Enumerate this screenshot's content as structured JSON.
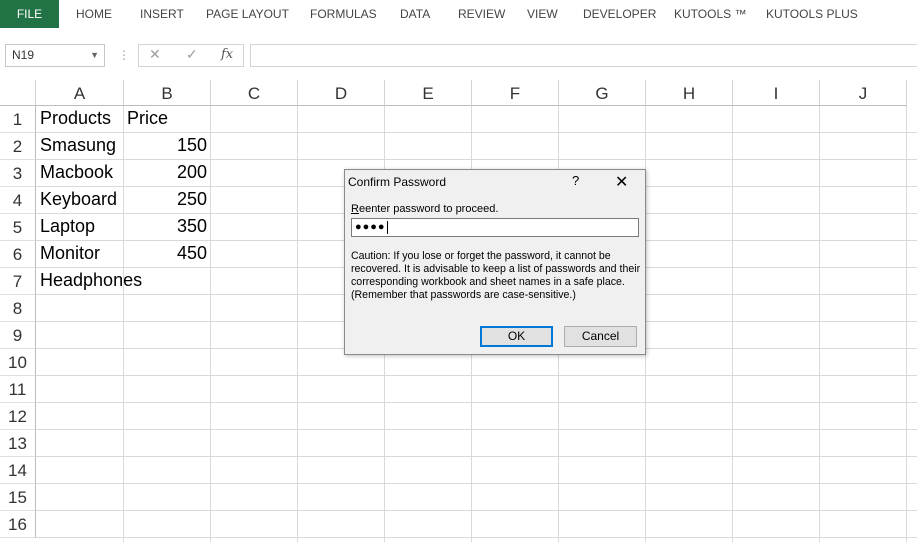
{
  "ribbon": {
    "tabs": [
      "FILE",
      "HOME",
      "INSERT",
      "PAGE LAYOUT",
      "FORMULAS",
      "DATA",
      "REVIEW",
      "VIEW",
      "DEVELOPER",
      "KUTOOLS ™",
      "KUTOOLS PLUS"
    ]
  },
  "formula_bar": {
    "name_box": "N19",
    "cancel_glyph": "✕",
    "enter_glyph": "✓",
    "fx_label": "fx",
    "formula_value": ""
  },
  "sheet": {
    "columns": [
      "A",
      "B",
      "C",
      "D",
      "E",
      "F",
      "G",
      "H",
      "I",
      "J"
    ],
    "rows": [
      "1",
      "2",
      "3",
      "4",
      "5",
      "6",
      "7",
      "8",
      "9",
      "10",
      "11",
      "12",
      "13",
      "14",
      "15",
      "16"
    ],
    "data": [
      [
        "Products",
        "Price"
      ],
      [
        "Smasung",
        "150"
      ],
      [
        "Macbook",
        "200"
      ],
      [
        "Keyboard",
        "250"
      ],
      [
        "Laptop",
        "350"
      ],
      [
        "Monitor",
        "450"
      ],
      [
        "Headphones",
        ""
      ]
    ]
  },
  "dialog": {
    "title": "Confirm Password",
    "help": "?",
    "close": "✕",
    "label_first": "R",
    "label_rest": "eenter password to proceed.",
    "password_mask": "●●●●",
    "caution": "Caution: If you lose or forget the password, it cannot be recovered. It is advisable to keep a list of passwords and their corresponding workbook and sheet names in a safe place.  (Remember that passwords are case-sensitive.)",
    "ok_label": "OK",
    "cancel_label": "Cancel"
  },
  "colors": {
    "file_tab": "#217346",
    "ok_focus": "#0078d7"
  }
}
